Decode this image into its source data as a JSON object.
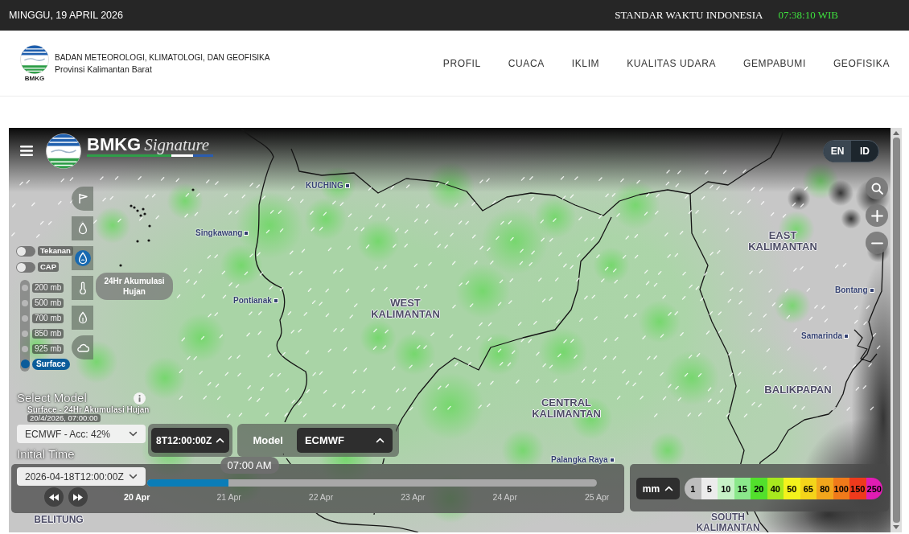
{
  "top_bar": {
    "date": "MINGGU, 19 APRIL 2026",
    "timezone_label": "STANDAR WAKTU INDONESIA",
    "clock": "07:38:10 WIB"
  },
  "header": {
    "logo_text": "BMKG",
    "agency": "BADAN METEOROLOGI, KLIMATOLOGI, DAN GEOFISIKA",
    "province": "Provinsi Kalimantan Barat",
    "nav": [
      "PROFIL",
      "CUACA",
      "IKLIM",
      "KUALITAS UDARA",
      "GEMPABUMI",
      "GEOFISIKA"
    ]
  },
  "map": {
    "brand": {
      "name": "BMKG",
      "subtitle": "Signature"
    },
    "languages": [
      {
        "label": "EN",
        "selected": true
      },
      {
        "label": "ID",
        "selected": false
      }
    ],
    "layers": [
      {
        "selected": false
      },
      {
        "selected": false
      },
      {
        "selected": true
      },
      {
        "selected": false
      },
      {
        "selected": false
      },
      {
        "selected": false
      }
    ],
    "layer_tooltip": "24Hr Akumulasi Hujan",
    "toggles": [
      {
        "label": "Tekanan",
        "on": false
      },
      {
        "label": "CAP",
        "on": false
      }
    ],
    "levels": [
      {
        "label": "200 mb",
        "selected": false
      },
      {
        "label": "500 mb",
        "selected": false
      },
      {
        "label": "700 mb",
        "selected": false
      },
      {
        "label": "850 mb",
        "selected": false
      },
      {
        "label": "925 mb",
        "selected": false
      },
      {
        "label": "Surface",
        "selected": true
      }
    ],
    "model_panel": {
      "title": "Select Model",
      "layer_title": "Surface - 24Hr Akumulasi Hujan",
      "valid_time": "20/4/2026, 07:00:00",
      "model_select": "ECMWF - Acc: 42%",
      "initial_time_label": "Initial Time",
      "initial_time_select": "2026-04-18T12:00:00Z"
    },
    "run_bar": {
      "initial_time_button": "8T12:00:00Z",
      "model_label": "Model",
      "model_button": "ECMWF"
    },
    "timeline": {
      "current_time": "07:00 AM",
      "level": 0.18,
      "days": [
        {
          "label": "20 Apr",
          "reached": true
        },
        {
          "label": "21 Apr",
          "reached": false
        },
        {
          "label": "22 Apr",
          "reached": false
        },
        {
          "label": "23 Apr",
          "reached": false
        },
        {
          "label": "24 Apr",
          "reached": false
        },
        {
          "label": "25 Apr",
          "reached": false
        }
      ]
    },
    "legend": {
      "unit": "mm",
      "items": [
        {
          "label": "1",
          "color": "#bdbdbd"
        },
        {
          "label": "5",
          "color": "#ececec"
        },
        {
          "label": "10",
          "color": "#c6f2c6"
        },
        {
          "label": "15",
          "color": "#8be88b"
        },
        {
          "label": "20",
          "color": "#52e02c"
        },
        {
          "label": "40",
          "color": "#a8e81e"
        },
        {
          "label": "50",
          "color": "#f4f21c"
        },
        {
          "label": "65",
          "color": "#f4d41a"
        },
        {
          "label": "80",
          "color": "#f2a61c"
        },
        {
          "label": "100",
          "color": "#f07a1a"
        },
        {
          "label": "150",
          "color": "#ee3a1c"
        },
        {
          "label": "250",
          "color": "#e01cb4"
        }
      ]
    },
    "places": [
      {
        "name": "KUCHING",
        "kind": "city"
      },
      {
        "name": "Singkawang",
        "kind": "city"
      },
      {
        "name": "EAST KALIMANTAN",
        "kind": "outlined"
      },
      {
        "name": "Bontang",
        "kind": "city"
      },
      {
        "name": "Pontianak",
        "kind": "city"
      },
      {
        "name": "WEST KALIMANTAN",
        "kind": "outlined"
      },
      {
        "name": "Samarinda",
        "kind": "city"
      },
      {
        "name": "BALIKPAPAN",
        "kind": "outlined"
      },
      {
        "name": "CENTRAL KALIMANTAN",
        "kind": "outlined"
      },
      {
        "name": "Palangka Raya",
        "kind": "city"
      },
      {
        "name": "BELITUNG",
        "kind": "outlined"
      },
      {
        "name": "SOUTH KALIMANTAN",
        "kind": "outlined"
      }
    ]
  }
}
